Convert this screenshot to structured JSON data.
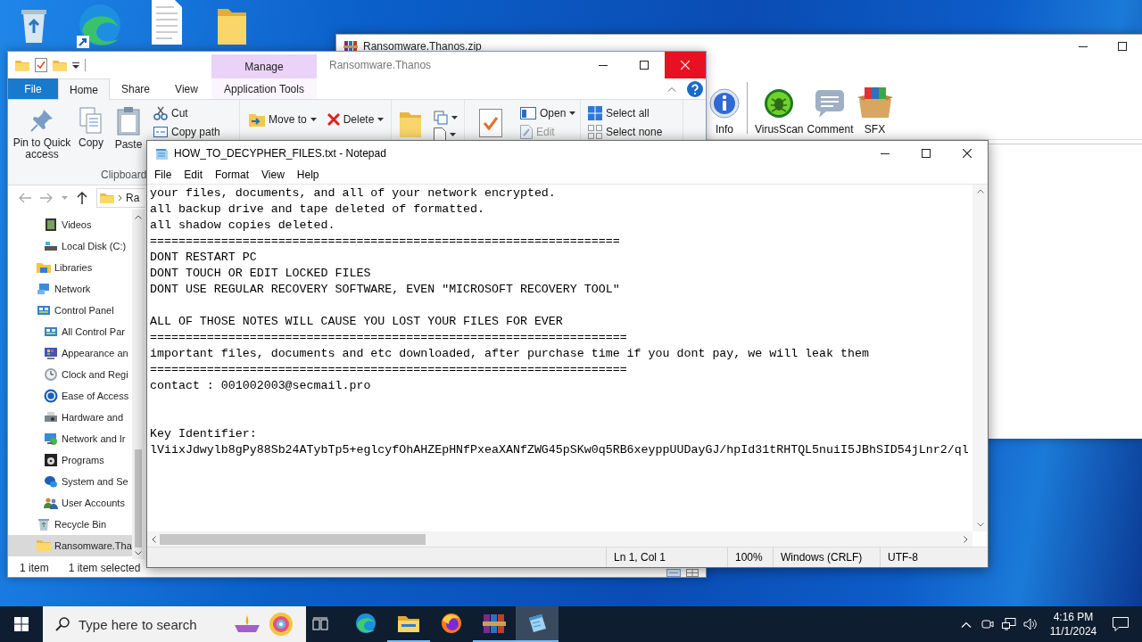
{
  "winrar": {
    "title": "Ransomware.Thanos.zip",
    "toolbar": [
      {
        "label": "Info",
        "kind": "info"
      },
      {
        "label": "VirusScan",
        "kind": "virus"
      },
      {
        "label": "Comment",
        "kind": "comment"
      },
      {
        "label": "SFX",
        "kind": "sfx"
      }
    ]
  },
  "explorer": {
    "title": "Ransomware.Thanos",
    "context_header": "Manage",
    "tabs": [
      {
        "label": "File",
        "kind": "file",
        "selected": false
      },
      {
        "label": "Home",
        "kind": "tab",
        "selected": true
      },
      {
        "label": "Share",
        "kind": "tab",
        "selected": false
      },
      {
        "label": "View",
        "kind": "tab",
        "selected": false
      },
      {
        "label": "Application Tools",
        "kind": "context",
        "selected": false
      }
    ],
    "ribbon": {
      "pin": "Pin to Quick access",
      "copy": "Copy",
      "paste": "Paste",
      "cut": "Cut",
      "copy_path": "Copy path",
      "clipboard_group": "Clipboard",
      "move_to": "Move to",
      "delete": "Delete",
      "open": "Open",
      "edit": "Edit",
      "edit_disabled": true,
      "select_all": "Select all",
      "select_none": "Select none"
    },
    "address": "Ra",
    "nav": [
      {
        "kind": "hidden-parent",
        "children": [
          {
            "label": "Videos",
            "kind": "video",
            "selected": false
          },
          {
            "label": "Local Disk (C:)",
            "kind": "disk",
            "selected": false
          }
        ]
      },
      {
        "label": "Libraries",
        "kind": "library",
        "selected": false
      },
      {
        "label": "Network",
        "kind": "network",
        "selected": false
      },
      {
        "label": "Control Panel",
        "kind": "panel",
        "selected": false,
        "children": [
          {
            "label": "All Control Par",
            "kind": "panel",
            "selected": false
          },
          {
            "label": "Appearance an",
            "kind": "appearance",
            "selected": false
          },
          {
            "label": "Clock and Regi",
            "kind": "clock",
            "selected": false
          },
          {
            "label": "Ease of Access",
            "kind": "access",
            "selected": false
          },
          {
            "label": "Hardware and",
            "kind": "hardware",
            "selected": false
          },
          {
            "label": "Network and Ir",
            "kind": "netinternet",
            "selected": false
          },
          {
            "label": "Programs",
            "kind": "programs",
            "selected": false
          },
          {
            "label": "System and Se",
            "kind": "security",
            "selected": false
          },
          {
            "label": "User Accounts",
            "kind": "users",
            "selected": false
          }
        ]
      },
      {
        "label": "Recycle Bin",
        "kind": "recycle",
        "selected": false
      },
      {
        "label": "Ransomware.Tha",
        "kind": "folder",
        "selected": true
      }
    ],
    "status": {
      "count": "1 item",
      "selection": "1 item selected"
    }
  },
  "notepad": {
    "title": "HOW_TO_DECYPHER_FILES.txt - Notepad",
    "menu": [
      "File",
      "Edit",
      "Format",
      "View",
      "Help"
    ],
    "lines": [
      {
        "kind": "text",
        "text": "your files, documents, and all of your network encrypted."
      },
      {
        "kind": "text",
        "text": "all backup drive and tape deleted of formatted."
      },
      {
        "kind": "text",
        "text": "all shadow copies deleted."
      },
      {
        "kind": "text",
        "text": "=================================================================="
      },
      {
        "kind": "text",
        "text": "DONT RESTART PC"
      },
      {
        "kind": "text",
        "text": "DONT TOUCH OR EDIT LOCKED FILES"
      },
      {
        "kind": "text",
        "text": "DONT USE REGULAR RECOVERY SOFTWARE, EVEN \"MICROSOFT RECOVERY TOOL\""
      },
      {
        "kind": "blank"
      },
      {
        "kind": "text",
        "text": "ALL OF THOSE NOTES WILL CAUSE YOU LOST YOUR FILES FOR EVER"
      },
      {
        "kind": "text",
        "text": "==================================================================="
      },
      {
        "kind": "text",
        "text": "important files, documents and etc downloaded, after purchase time if you dont pay, we will leak them"
      },
      {
        "kind": "text",
        "text": "==================================================================="
      },
      {
        "kind": "text",
        "text": "contact : 001002003@secmail.pro"
      },
      {
        "kind": "blank"
      },
      {
        "kind": "blank"
      },
      {
        "kind": "text",
        "text": "Key Identifier:"
      },
      {
        "kind": "text",
        "text": "lViixJdwylb8gPy88Sb24ATybTp5+eglcyfOhAHZEpHNfPxeaXANfZWG45pSKw0q5RB6xeyppUUDayGJ/hpId31tRHTQL5nuiI5JBhSID54jLnr2/ql"
      }
    ],
    "status": [
      "Ln 1, Col 1",
      "100%",
      "Windows (CRLF)",
      "UTF-8"
    ]
  },
  "taskbar": {
    "search_placeholder": "Type here to search",
    "apps": [
      {
        "kind": "edge",
        "running": false,
        "selected": false
      },
      {
        "kind": "explorer",
        "running": true,
        "selected": false
      },
      {
        "kind": "firefox",
        "running": false,
        "selected": false
      },
      {
        "kind": "winrar",
        "running": true,
        "selected": false
      },
      {
        "kind": "notepad",
        "running": true,
        "selected": true
      }
    ],
    "time": "4:16 PM",
    "date": "11/1/2024"
  }
}
